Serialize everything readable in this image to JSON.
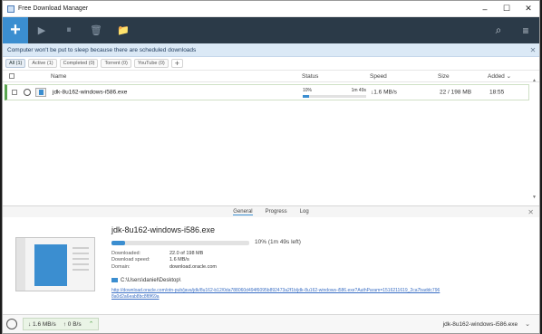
{
  "window": {
    "title": "Free Download Manager",
    "minimize": "–",
    "maximize": "☐",
    "close": "✕"
  },
  "toolbar": {
    "add": "+",
    "resume": "▶",
    "pause": "⏸",
    "delete": "🗑",
    "move": "📁",
    "search": "⌕",
    "menu": "≡"
  },
  "notice": {
    "text": "Computer won't be put to sleep because there are scheduled downloads",
    "close": "✕"
  },
  "filters": [
    {
      "label": "All (1)",
      "active": true
    },
    {
      "label": "Active (1)",
      "active": false
    },
    {
      "label": "Completed (0)",
      "active": false
    },
    {
      "label": "Torrent (0)",
      "active": false
    },
    {
      "label": "YouTube (0)",
      "active": false
    }
  ],
  "filter_add": "+",
  "columns": {
    "name": "Name",
    "status": "Status",
    "speed": "Speed",
    "size": "Size",
    "added": "Added"
  },
  "download": {
    "name": "jdk-8u162-windows-i586.exe",
    "percent_label": "10%",
    "eta": "1m 49s",
    "progress": 0.1,
    "speed": "↓1.6 MB/s",
    "size": "22 / 198 MB",
    "added": "18:55"
  },
  "details": {
    "tabs": [
      "General",
      "Progress",
      "Log"
    ],
    "active_tab": "General",
    "close": "✕",
    "title": "jdk-8u162-windows-i586.exe",
    "progress_text": "10% (1m 49s left)",
    "downloaded_label": "Downloaded:",
    "downloaded": "22.0 of 198 MB",
    "speed_label": "Download speed:",
    "speed": "1.6 MB/s",
    "domain_label": "Domain:",
    "domain": "download.oracle.com",
    "folder": "C:\\Users\\daniel\\Desktop\\",
    "url": "http://download.oracle.com/otn-pub/java/jdk/8u162-b12/0da788060d494f6095b892473a2f1b/jdk-8u162-windows-i586.exe?AuthParam=1516211619_2ca7baddc7968a0d2a6eab8bc8f8f69a"
  },
  "statusbar": {
    "down": "↓ 1.6 MB/s",
    "up": "↑ 0 B/s",
    "caret": "⌃",
    "file": "jdk-8u162-windows-i586.exe",
    "file_caret": "⌄"
  }
}
